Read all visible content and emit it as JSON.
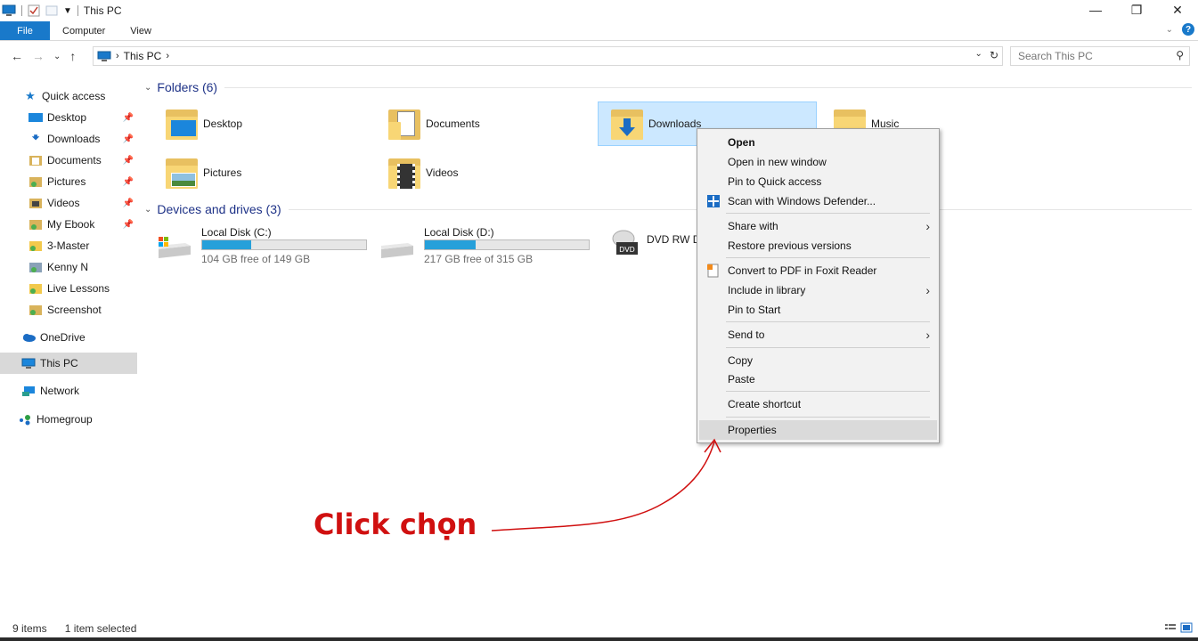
{
  "window": {
    "title": "This PC"
  },
  "ribbon": {
    "tabs": [
      "File",
      "Computer",
      "View"
    ]
  },
  "address": {
    "segments": [
      "This PC"
    ],
    "search_placeholder": "Search This PC"
  },
  "nav": {
    "items": [
      {
        "label": "Quick access"
      },
      {
        "label": "Desktop"
      },
      {
        "label": "Downloads"
      },
      {
        "label": "Documents"
      },
      {
        "label": "Pictures"
      },
      {
        "label": "Videos"
      },
      {
        "label": "My Ebook"
      },
      {
        "label": "3-Master"
      },
      {
        "label": "Kenny N"
      },
      {
        "label": "Live Lessons"
      },
      {
        "label": "Screenshot"
      },
      {
        "label": "OneDrive"
      },
      {
        "label": "This PC"
      },
      {
        "label": "Network"
      },
      {
        "label": "Homegroup"
      }
    ]
  },
  "content": {
    "folders_header": "Folders (6)",
    "folders": [
      "Desktop",
      "Documents",
      "Downloads",
      "Music",
      "Pictures",
      "Videos"
    ],
    "devices_header": "Devices and drives (3)",
    "drives": [
      {
        "name": "Local Disk (C:)",
        "free": "104 GB free of 149 GB",
        "used_fraction": 0.3
      },
      {
        "name": "Local Disk (D:)",
        "free": "217 GB free of 315 GB",
        "used_fraction": 0.31
      },
      {
        "name": "DVD RW D"
      }
    ]
  },
  "context_menu": {
    "items": [
      "Open",
      "Open in new window",
      "Pin to Quick access",
      "Scan with Windows Defender...",
      "Share with",
      "Restore previous versions",
      "Convert to PDF in Foxit Reader",
      "Include in library",
      "Pin to Start",
      "Send to",
      "Copy",
      "Paste",
      "Create shortcut",
      "Properties"
    ]
  },
  "annotation": {
    "text": "Click chọn"
  },
  "status": {
    "items": "9 items",
    "selected": "1 item selected"
  },
  "colors": {
    "accent": "#1979ca",
    "selection": "#cce8ff",
    "annotation": "#d01010",
    "drive_fill": "#26a0da"
  }
}
